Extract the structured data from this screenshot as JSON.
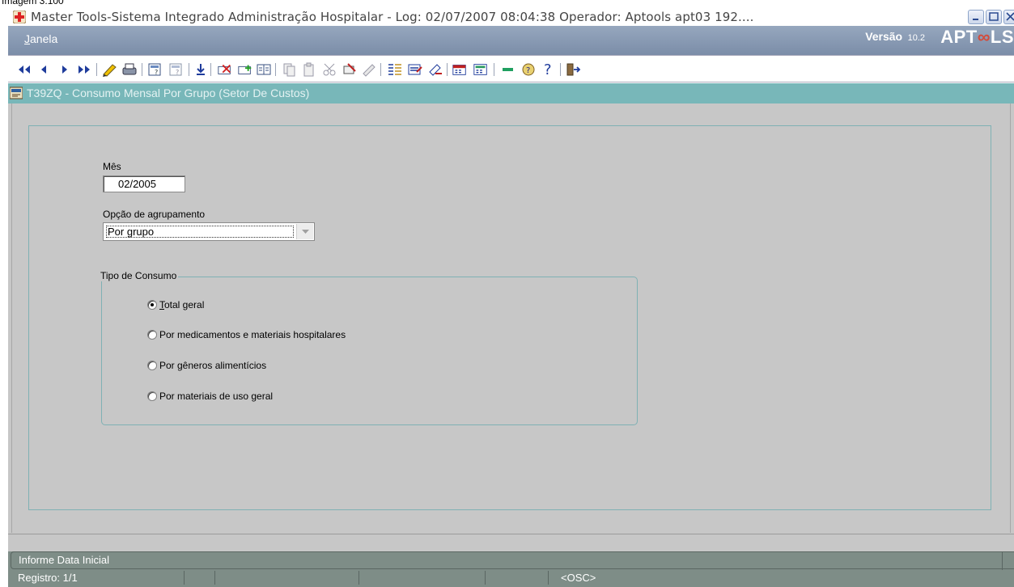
{
  "caption": "Imagem 3.100",
  "window": {
    "title": "Master Tools-Sistema Integrado Administração Hospitalar - Log: 02/07/2007 08:04:38 Operador: Aptools apt03 192....",
    "controls": [
      "minimize-icon",
      "maximize-icon",
      "close-icon"
    ]
  },
  "menu": {
    "janela": "Janela",
    "versao_label": "Versão",
    "versao_number": "10.2",
    "brand_a": "APT",
    "brand_b": "LS"
  },
  "toolbar": {
    "icons": [
      "first-record-icon",
      "previous-record-icon",
      "next-record-icon",
      "last-record-icon",
      "edit-pencil-icon",
      "print-icon",
      "query-enter-icon",
      "query-execute-icon",
      "save-download-icon",
      "delete-record-icon",
      "insert-record-icon",
      "duplicate-record-icon",
      "copy-icon",
      "paste-icon",
      "cut-icon",
      "attach-icon",
      "clear-icon",
      "list-values-icon",
      "edit-field-icon",
      "clear-field-icon",
      "calendar-icon",
      "calculator-icon",
      "minimize-bar-icon",
      "help-icon",
      "question-icon",
      "exit-door-icon"
    ]
  },
  "form": {
    "code_title": "T39ZQ - Consumo Mensal Por Grupo (Setor De Custos)",
    "mes_label": "Mês",
    "mes_value": "02/2005",
    "agrupamento_label": "Opção de agrupamento",
    "agrupamento_value": "Por grupo",
    "tipo_consumo_label": "Tipo de Consumo",
    "radio_options": [
      {
        "label_first": "T",
        "label_rest": "otal geral",
        "checked": true
      },
      {
        "label_first": "",
        "label_rest": "Por medicamentos e materiais hospitalares",
        "checked": false
      },
      {
        "label_first": "",
        "label_rest": "Por gêneros alimentícios",
        "checked": false
      },
      {
        "label_first": "",
        "label_rest": "Por materiais de uso geral",
        "checked": false
      }
    ]
  },
  "status": {
    "message": "Informe Data Inicial",
    "registro": "Registro: 1/1",
    "mode": "<OSC>"
  },
  "colors": {
    "form_title_bg": "#78b7b9",
    "form_bg": "#c7c7c7",
    "menubar_bg": "#8a9bb4",
    "statusbar_bg": "#7e8d87",
    "toolbar_icon_blue": "#1f3c9c"
  }
}
